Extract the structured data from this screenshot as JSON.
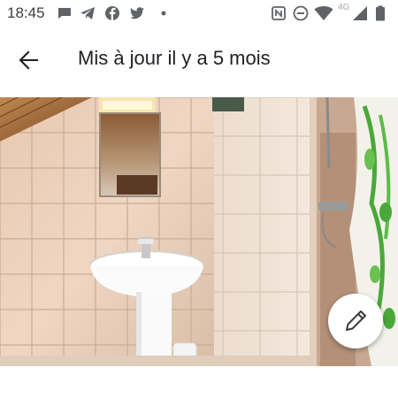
{
  "status_bar": {
    "time": "18:45",
    "left_icons": [
      "chat-icon",
      "telegram-icon",
      "facebook-icon",
      "twitter-icon",
      "dot-icon"
    ],
    "right_icons": [
      "nfc-icon",
      "do-not-disturb-icon",
      "wifi-icon",
      "signal-icon",
      "battery-icon"
    ],
    "network_label": "4G"
  },
  "app_bar": {
    "title": "Mis à jour il y a 5 mois",
    "back_icon": "arrow-back-icon"
  },
  "photo": {
    "subject": "bathroom-photo"
  },
  "fab": {
    "icon": "pencil-icon",
    "color": "#ffffff"
  },
  "colors": {
    "icon_gray": "#5f6368",
    "text_dark": "#202124"
  }
}
